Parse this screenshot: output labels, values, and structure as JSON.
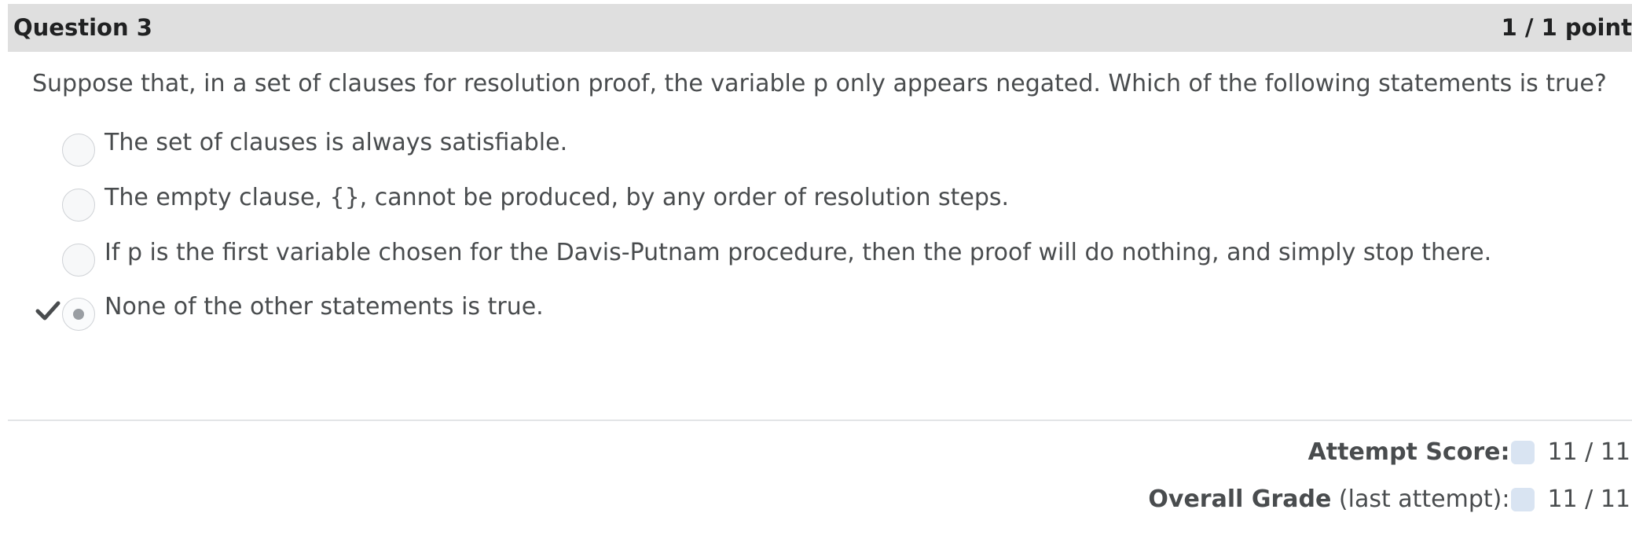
{
  "question": {
    "title": "Question 3",
    "points": "1 / 1 point",
    "prompt": "Suppose that, in a set of clauses for resolution proof, the variable p only appears negated. Which of the following statements is true?",
    "options": [
      {
        "label": "The set of clauses is always satisfiable.",
        "selected": false,
        "correct": false
      },
      {
        "label": "The empty clause, {}, cannot be produced, by any order of resolution steps.",
        "selected": false,
        "correct": false
      },
      {
        "label": "If p is the first variable chosen for the Davis-Putnam procedure, then the proof will do nothing, and simply stop there.",
        "selected": false,
        "correct": false
      },
      {
        "label": "None of the other statements is true.",
        "selected": true,
        "correct": true
      }
    ]
  },
  "summary": {
    "attempt_score_label": "Attempt Score:",
    "attempt_score_value": "11 / 11",
    "overall_grade_label": "Overall Grade",
    "overall_grade_suffix": "(last attempt):",
    "overall_grade_value": "11 / 11"
  },
  "icons": {
    "correct": "checkmark-icon"
  },
  "colors": {
    "header_bg": "#dfdfdf",
    "text": "#494c4e",
    "badge": "#d9e4f2"
  }
}
